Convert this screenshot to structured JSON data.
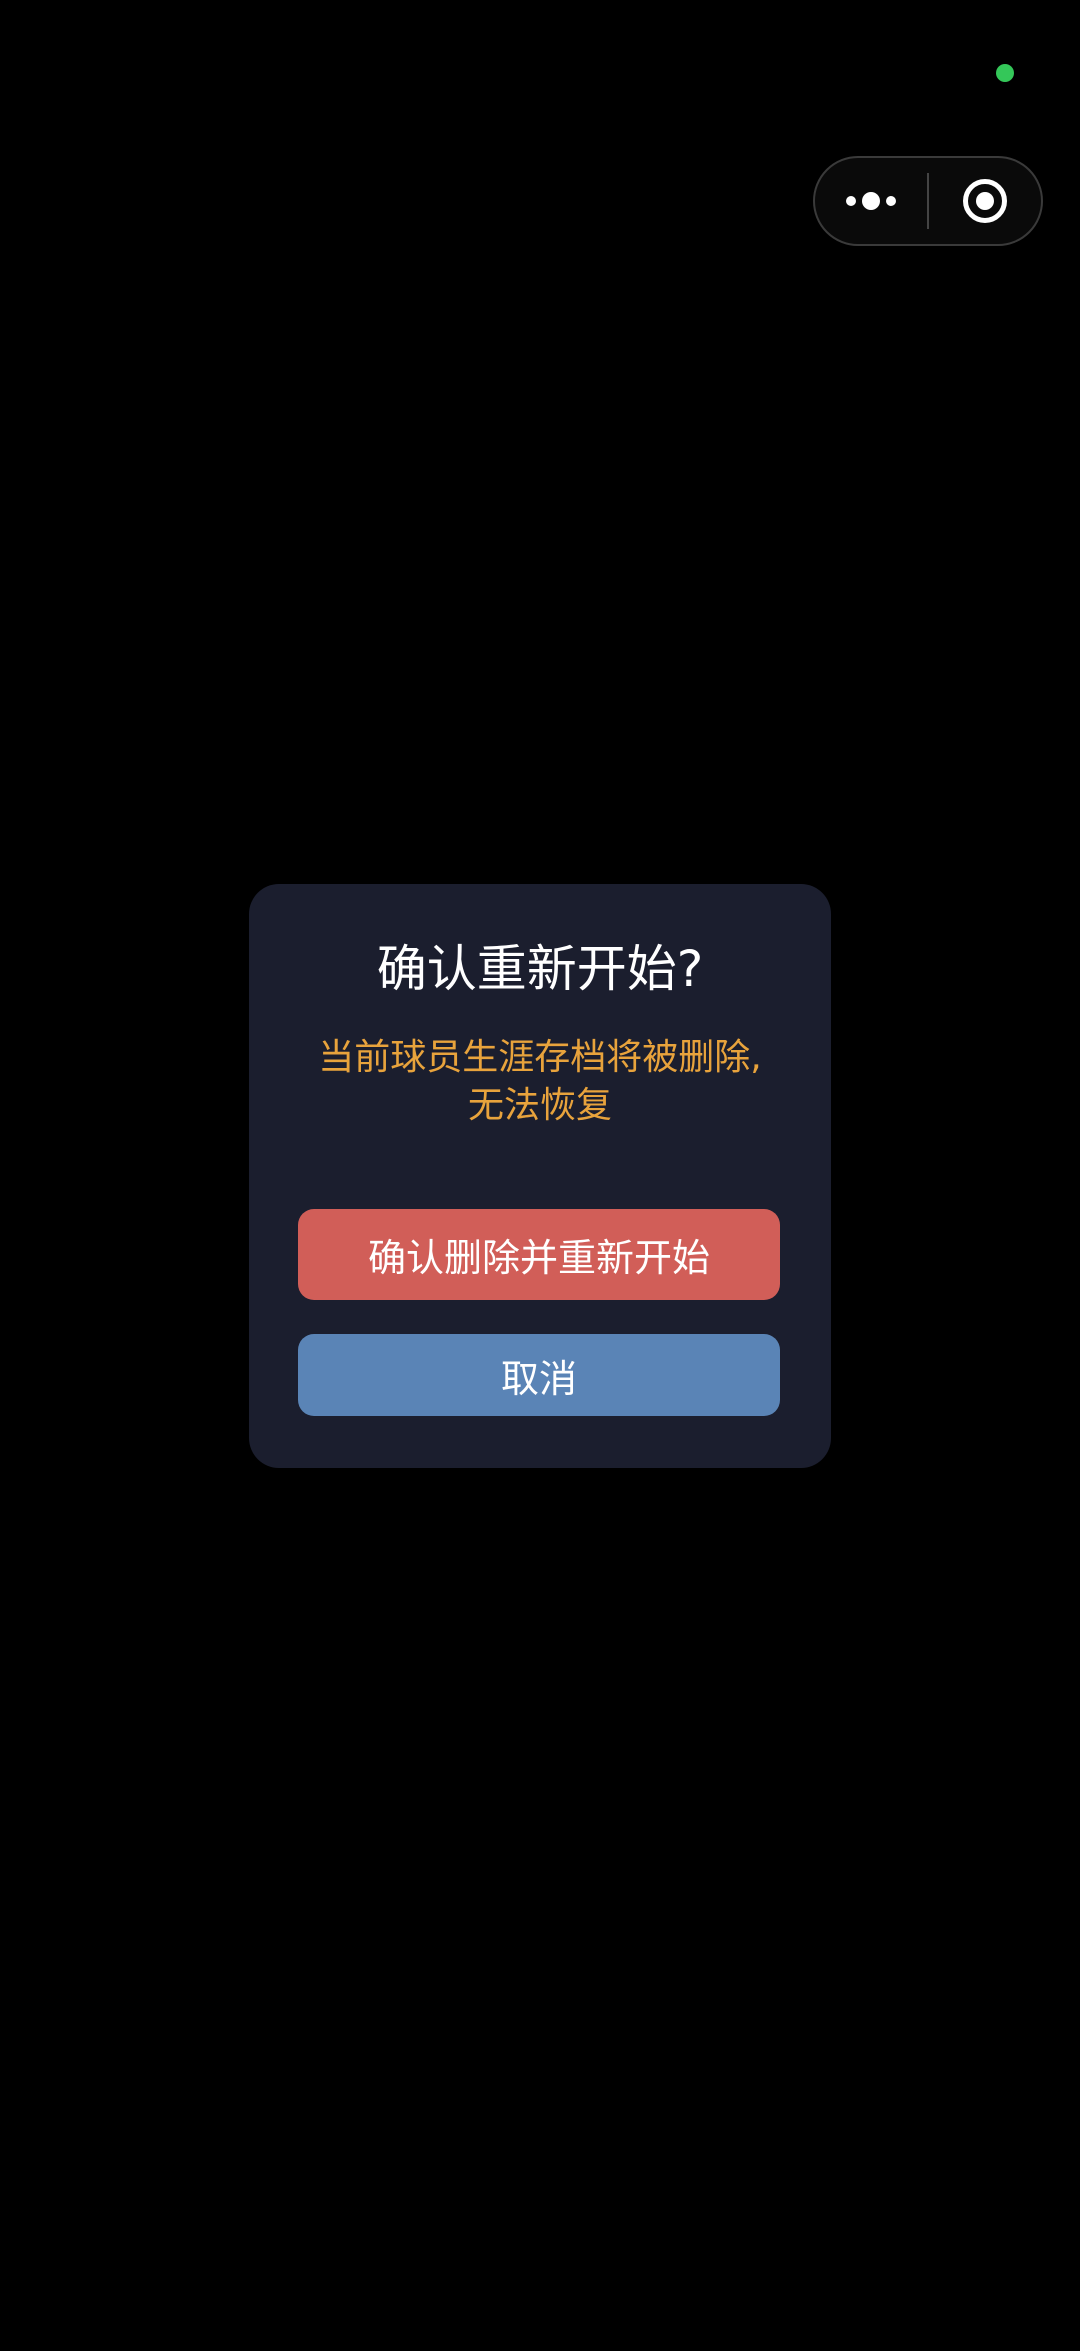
{
  "colors": {
    "background": "#000000",
    "status_dot": "#34c759",
    "dialog_bg": "#1b1e2e",
    "title": "#ffffff",
    "warning_text": "#e8a33c",
    "confirm_button": "#d15e58",
    "cancel_button": "#5a84b6"
  },
  "capsule": {
    "more_icon": "more-dots-icon",
    "close_icon": "target-circle-icon"
  },
  "dialog": {
    "title": "确认重新开始?",
    "message_line1": "当前球员生涯存档将被删除,",
    "message_line2": "无法恢复",
    "confirm_label": "确认删除并重新开始",
    "cancel_label": "取消"
  }
}
